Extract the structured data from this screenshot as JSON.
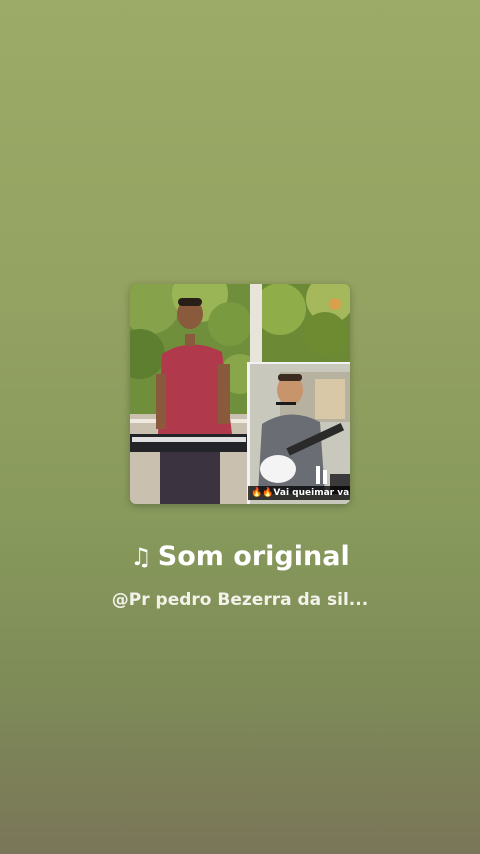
{
  "sound": {
    "note_icon": "music-note-icon",
    "title": "Som original",
    "author": "@Pr pedro Bezerra da sil..."
  },
  "cover": {
    "caption": "🔥🔥Vai queimar va"
  }
}
